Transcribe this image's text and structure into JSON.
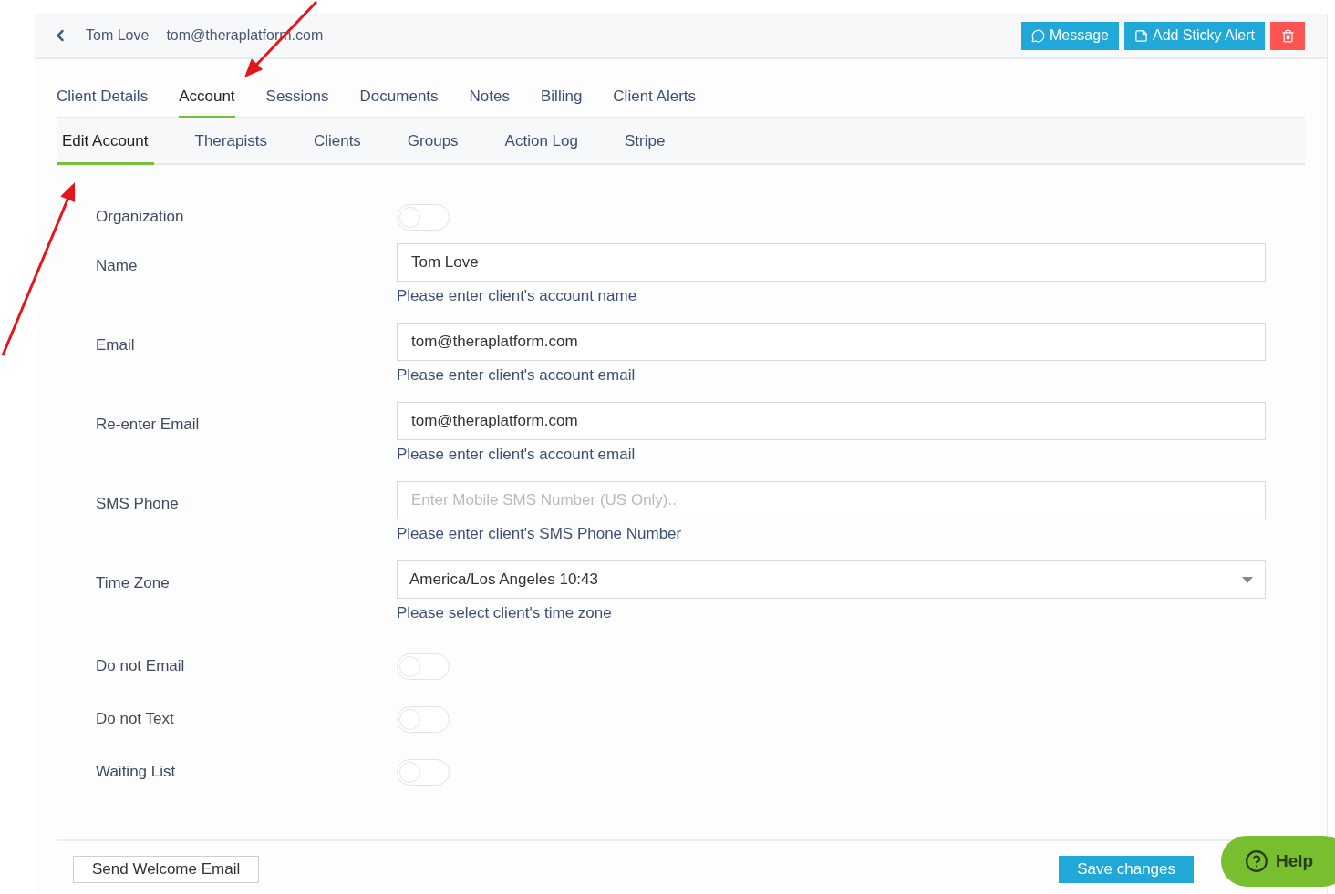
{
  "header": {
    "client_name": "Tom Love",
    "client_email": "tom@theraplatform.com",
    "buttons": [
      {
        "kind": "message",
        "label": "Message"
      },
      {
        "kind": "sticky",
        "label": "Add Sticky Alert"
      },
      {
        "kind": "delete"
      }
    ]
  },
  "tabs": [
    {
      "label": "Client Details",
      "selected": false
    },
    {
      "label": "Account",
      "selected": true
    },
    {
      "label": "Sessions",
      "selected": false
    },
    {
      "label": "Documents",
      "selected": false
    },
    {
      "label": "Notes",
      "selected": false
    },
    {
      "label": "Billing",
      "selected": false
    },
    {
      "label": "Client Alerts",
      "selected": false
    }
  ],
  "subtabs": [
    {
      "label": "Edit Account",
      "selected": true
    },
    {
      "label": "Therapists",
      "selected": false
    },
    {
      "label": "Clients",
      "selected": false
    },
    {
      "label": "Groups",
      "selected": false
    },
    {
      "label": "Action Log",
      "selected": false
    },
    {
      "label": "Stripe",
      "selected": false
    }
  ],
  "form": [
    {
      "kind": "toggle",
      "label": "Organization",
      "on": false
    },
    {
      "kind": "input",
      "label": "Name",
      "value": "Tom Love",
      "help": "Please enter client's account name"
    },
    {
      "kind": "input",
      "label": "Email",
      "value": "tom@theraplatform.com",
      "help": "Please enter client's account email"
    },
    {
      "kind": "input",
      "label": "Re-enter Email",
      "value": "tom@theraplatform.com",
      "help": "Please enter client's account email"
    },
    {
      "kind": "input",
      "label": "SMS Phone",
      "placeholder": "Enter Mobile SMS Number (US Only)..",
      "help": "Please enter client's SMS Phone Number"
    },
    {
      "kind": "select",
      "label": "Time Zone",
      "value": "America/Los Angeles 10:43",
      "help": "Please select client's time zone"
    },
    {
      "kind": "toggle",
      "label": "Do not Email",
      "on": false
    },
    {
      "kind": "toggle",
      "label": "Do not Text",
      "on": false
    },
    {
      "kind": "toggle",
      "label": "Waiting List",
      "on": false
    }
  ],
  "footer": {
    "send_welcome": "Send Welcome Email",
    "save": "Save changes"
  },
  "help_button": "Help"
}
